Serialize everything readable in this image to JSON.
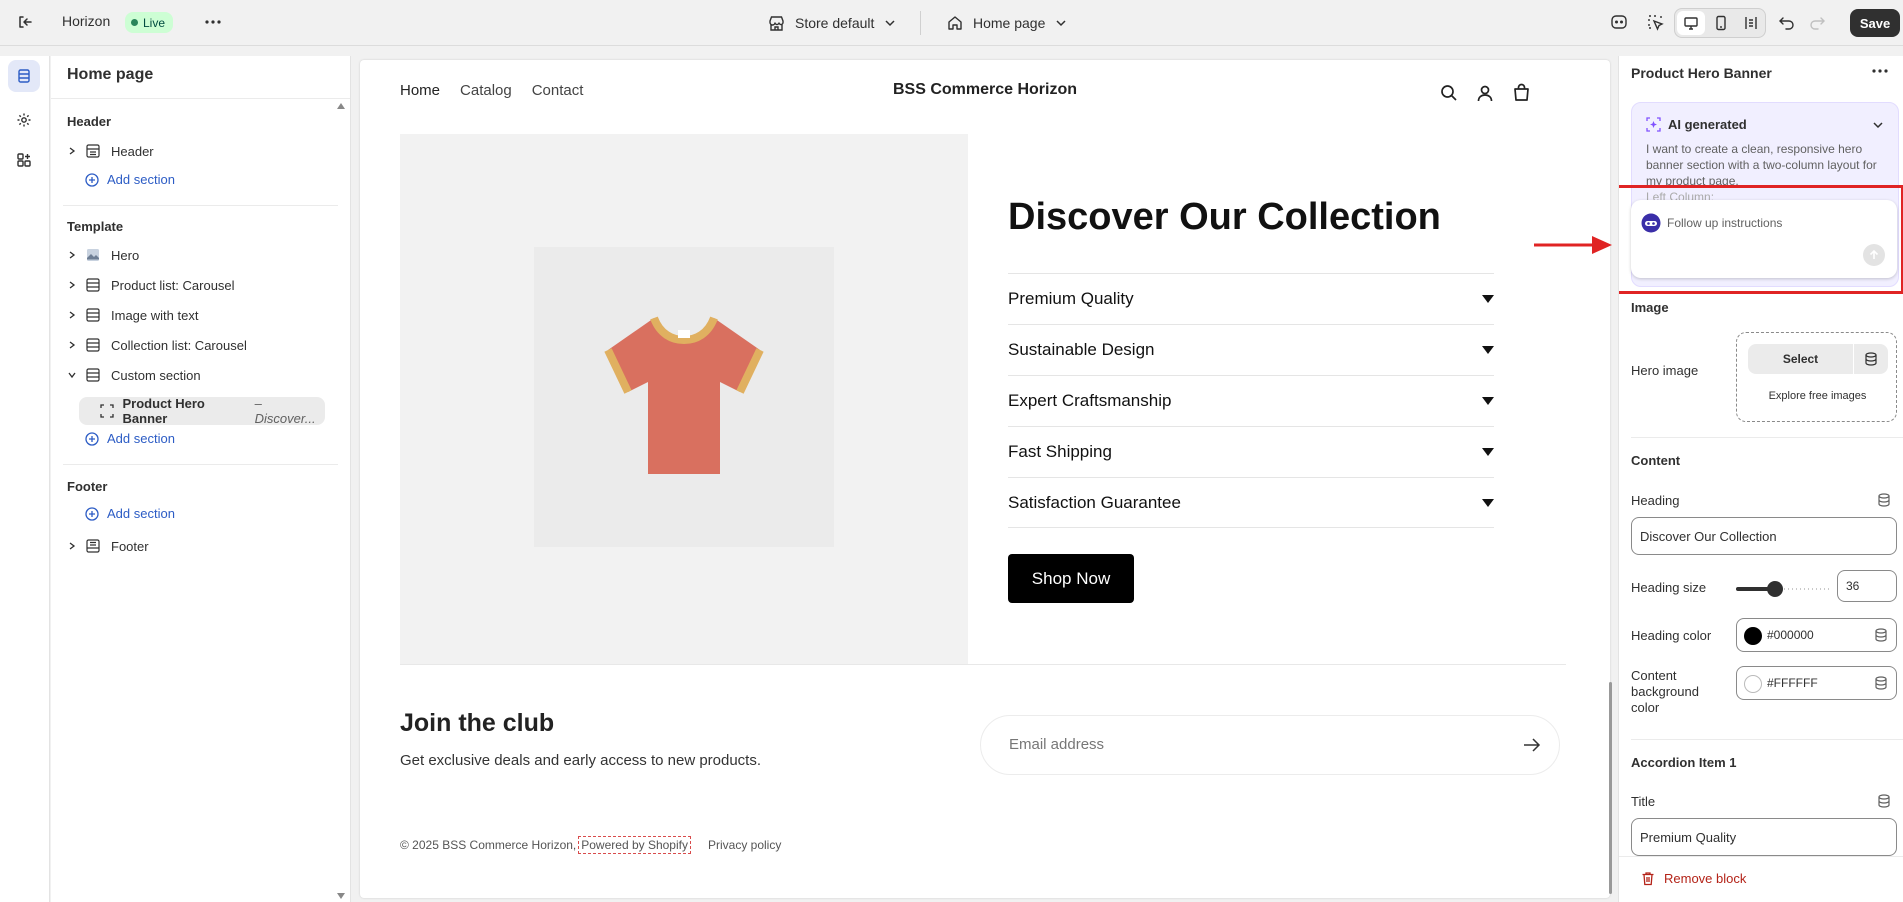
{
  "topbar": {
    "app_name": "Horizon",
    "status": "Live",
    "store_select": "Store default",
    "page_select": "Home page",
    "save_label": "Save"
  },
  "left": {
    "title": "Home page",
    "groups": {
      "header": "Header",
      "template": "Template",
      "footer": "Footer"
    },
    "header_item": "Header",
    "add_section": "Add section",
    "template_items": [
      "Hero",
      "Product list: Carousel",
      "Image with text",
      "Collection list: Carousel",
      "Custom section"
    ],
    "custom_child_name": "Product Hero Banner",
    "custom_child_sub": "– Discover...",
    "footer_item": "Footer"
  },
  "store": {
    "brand": "BSS Commerce Horizon",
    "nav": [
      "Home",
      "Catalog",
      "Contact"
    ],
    "hero_heading": "Discover Our Collection",
    "accordion": [
      "Premium Quality",
      "Sustainable Design",
      "Expert Craftsmanship",
      "Fast Shipping",
      "Satisfaction Guarantee"
    ],
    "cta": "Shop Now",
    "join_title": "Join the club",
    "join_sub": "Get exclusive deals and early access to new products.",
    "email_placeholder": "Email address",
    "copyright": "© 2025 BSS Commerce Horizon,",
    "powered": "Powered by Shopify",
    "privacy": "Privacy policy"
  },
  "right": {
    "title": "Product Hero Banner",
    "ai_label": "AI generated",
    "ai_text": "I want to create a clean, responsive hero banner section with a two-column layout for my product page.",
    "ai_text_cut": "Left Column:",
    "followup_placeholder": "Follow up instructions",
    "image_section": "Image",
    "hero_image_label": "Hero image",
    "select_btn": "Select",
    "explore": "Explore free images",
    "content_section": "Content",
    "heading_label": "Heading",
    "heading_value": "Discover Our Collection",
    "heading_size_label": "Heading size",
    "heading_size_value": "36",
    "heading_size_fraction": 0.42,
    "heading_color_label": "Heading color",
    "heading_color_value": "#000000",
    "bg_color_label": "Content background color",
    "bg_color_value": "#FFFFFF",
    "accordion_section": "Accordion Item 1",
    "title_label": "Title",
    "title_value": "Premium Quality",
    "remove": "Remove block"
  },
  "colors": {
    "accent": "#2c5cc5",
    "live_bg": "#cdfed4",
    "live_text": "#014b40",
    "annotation": "#e02424",
    "tshirt": "#d9705f",
    "tshirt_trim": "#e0b060",
    "ai_purple": "#8051ff"
  }
}
